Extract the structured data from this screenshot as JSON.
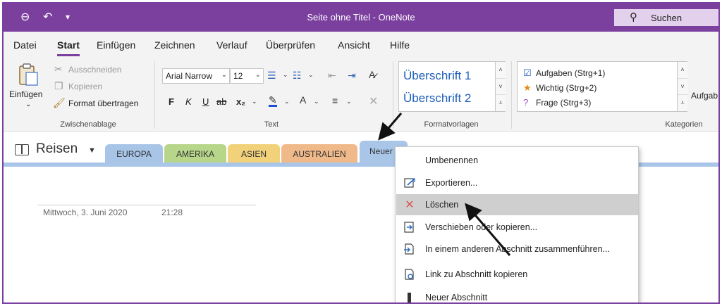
{
  "window": {
    "title": "Seite ohne Titel  -  OneNote",
    "search_label": "Suchen"
  },
  "quick_access": {
    "back_icon": "back-circle-icon",
    "undo_icon": "undo-icon",
    "customize_icon": "customize-qat-icon"
  },
  "menu": {
    "tabs": [
      "Datei",
      "Start",
      "Einfügen",
      "Zeichnen",
      "Verlauf",
      "Überprüfen",
      "Ansicht",
      "Hilfe"
    ],
    "active": "Start"
  },
  "ribbon": {
    "clipboard": {
      "paste": "Einfügen",
      "cut": "Ausschneiden",
      "copy": "Kopieren",
      "format_painter": "Format übertragen",
      "label": "Zwischenablage"
    },
    "text": {
      "font": "Arial Narrow",
      "size": "12",
      "bold": "F",
      "italic": "K",
      "underline": "U",
      "strike": "ab",
      "subscript": "x₂",
      "label": "Text"
    },
    "styles": {
      "heading1": "Überschrift 1",
      "heading2": "Überschrift 2",
      "label": "Formatvorlagen"
    },
    "tags": {
      "items": [
        "Aufgaben (Strg+1)",
        "Wichtig (Strg+2)",
        "Frage (Strg+3)"
      ],
      "more": "Aufgab",
      "label": "Kategorien"
    }
  },
  "notebook": {
    "name": "Reisen",
    "sections": [
      {
        "label": "EUROPA",
        "color": "#a8c5e8"
      },
      {
        "label": "AMERIKA",
        "color": "#b7d68a"
      },
      {
        "label": "ASIEN",
        "color": "#f1d27a"
      },
      {
        "label": "AUSTRALIEN",
        "color": "#f0b98a"
      },
      {
        "label": "Neuer",
        "color": "#a9c6e8"
      }
    ]
  },
  "page": {
    "date": "Mittwoch, 3. Juni 2020",
    "time": "21:28"
  },
  "context_menu": {
    "items": [
      {
        "label": "Umbenennen",
        "icon": "none"
      },
      {
        "label": "Exportieren...",
        "icon": "export-icon"
      },
      {
        "label": "Löschen",
        "icon": "delete-x-icon"
      },
      {
        "label": "Verschieben oder kopieren...",
        "icon": "move-copy-icon"
      },
      {
        "label": "In einem anderen Abschnitt zusammenführen...",
        "icon": "merge-icon"
      },
      {
        "label": "Link zu Abschnitt kopieren",
        "icon": "link-icon"
      },
      {
        "label": "Neuer Abschnitt",
        "icon": "new-section-icon"
      }
    ],
    "highlighted": "Löschen"
  },
  "colors": {
    "accent": "#7b3f9e",
    "heading": "#1f5fb8",
    "delete": "#d9534f"
  }
}
